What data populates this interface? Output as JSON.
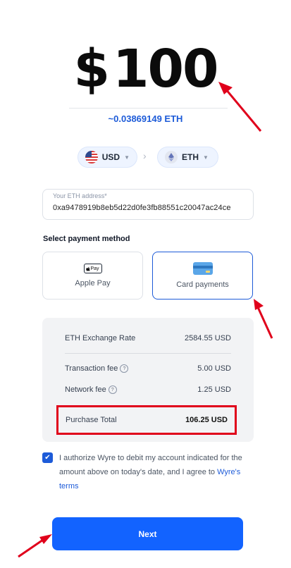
{
  "amount": {
    "currency_symbol": "$",
    "value": "100"
  },
  "crypto_estimate": "~0.03869149 ETH",
  "currency_selector": {
    "from": {
      "code": "USD",
      "icon": "us-flag-icon"
    },
    "to": {
      "code": "ETH",
      "icon": "ethereum-icon"
    }
  },
  "address_field": {
    "label": "Your ETH address*",
    "value": "0xa9478919b8eb5d22d0fe3fb88551c20047ac24ce"
  },
  "payment": {
    "heading": "Select payment method",
    "options": [
      {
        "label": "Apple Pay",
        "icon_text": "Pay",
        "icon": "apple-pay-icon",
        "selected": false
      },
      {
        "label": "Card payments",
        "icon": "credit-card-icon",
        "selected": true
      }
    ]
  },
  "summary": {
    "exchange_rate": {
      "label": "ETH Exchange Rate",
      "value": "2584.55 USD"
    },
    "transaction_fee": {
      "label": "Transaction fee",
      "value": "5.00 USD"
    },
    "network_fee": {
      "label": "Network fee",
      "value": "1.25 USD"
    },
    "total": {
      "label": "Purchase Total",
      "value": "106.25 USD"
    }
  },
  "consent": {
    "checked": true,
    "text": "I authorize Wyre to debit my account indicated for the amount above on today's date, and I agree to",
    "link": "Wyre's terms"
  },
  "next_button": {
    "label": "Next"
  },
  "colors": {
    "accent": "#1263ff",
    "link": "#1d5bd8",
    "annotation_red": "#e0001b"
  }
}
